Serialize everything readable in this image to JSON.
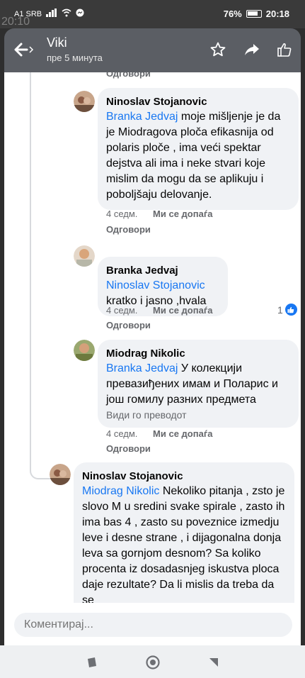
{
  "status_bar": {
    "ghost_time": "20:10",
    "carrier": "A1 SRB",
    "battery": "76%",
    "time": "20:18"
  },
  "header": {
    "title": "Viki",
    "subtitle": "пре 5 минута",
    "icons": [
      "back-arrow-icon",
      "star-icon",
      "share-arrow-icon",
      "thumbs-up-icon"
    ]
  },
  "thread": {
    "top_reply_label": "Одговори",
    "comments": [
      {
        "author": "Ninoslav Stojanovic",
        "mention": "Branka Jedvaj",
        "text": " moje mišljenje je da je Miodragova ploča efikasnija od polaris ploče , ima veći spektar dejstva ali ima i neke stvari koje mislim da mogu da se aplikuju i poboljšaju delovanje.",
        "time": "4 седм.",
        "like_label": "Ми се допаѓа",
        "reply_label": "Одговори"
      },
      {
        "author": "Branka Jedvaj",
        "mention": "Ninoslav Stojanovic",
        "text": " kratko i jasno ,hvala",
        "time": "4 седм.",
        "like_label": "Ми се допаѓа",
        "reply_label": "Одговори",
        "reaction_count": "1"
      },
      {
        "author": "Miodrag Nikolic",
        "mention": "Branka Jedvaj",
        "text": " У колекцији превазиђених имам и Поларис и још гомилу разних предмета",
        "translate_label": "Види го преводот",
        "time": "4 седм.",
        "like_label": "Ми се допаѓа",
        "reply_label": "Одговори"
      },
      {
        "author": "Ninoslav Stojanovic",
        "mention": "Miodrag Nikolic",
        "text": " Nekoliko pitanja , zsto je slovo M u sredini svake spirale , zasto ih ima bas 4 , zasto su poveznice izmedju leve i desne strane , i dijagonalna donja leva sa gornjom desnom? Sa koliko procenta iz dosadasnjeg iskustva ploca daje rezultate? Da li mislis da treba da se"
      }
    ]
  },
  "comment_input": {
    "placeholder": "Коментирај..."
  },
  "colors": {
    "mention": "#1877f2",
    "bubble": "#f0f2f5",
    "header": "#5b5e64"
  }
}
